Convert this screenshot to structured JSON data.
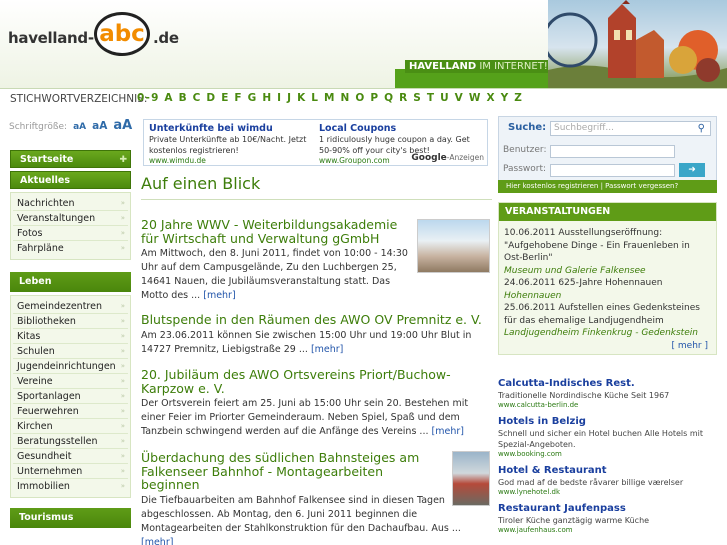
{
  "header": {
    "logo_left": "havelland-",
    "logo_abc": "abc",
    "logo_right": ".de",
    "slogan_main": "HAVELLAND",
    "slogan_rest": " IM INTERNET!"
  },
  "stichwort": {
    "label": "STICHWORTVERZEICHNIS:",
    "letters": "0-9 A B C D E F G H I J K L M N O P Q R S T U V W X Y Z"
  },
  "fontsize": {
    "label": "Schriftgröße:",
    "small": "aA",
    "medium": "aA",
    "large": "aA"
  },
  "nav": {
    "startseite": "Startseite",
    "aktuelles": "Aktuelles",
    "aktuelles_items": [
      "Nachrichten",
      "Veranstaltungen",
      "Fotos",
      "Fahrpläne"
    ],
    "leben": "Leben",
    "leben_items": [
      "Gemeindezentren",
      "Bibliotheken",
      "Kitas",
      "Schulen",
      "Jugendeinrichtungen",
      "Vereine",
      "Sportanlagen",
      "Feuerwehren",
      "Kirchen",
      "Beratungsstellen",
      "Gesundheit",
      "Unternehmen",
      "Immobilien"
    ],
    "tourismus": "Tourismus"
  },
  "ads_top": [
    {
      "title": "Unterkünfte bei wimdu",
      "desc": "Private Unterkünfte ab 10€/Nacht. Jetzt kostenlos registrieren!",
      "url": "www.wimdu.de"
    },
    {
      "title": "Local Coupons",
      "desc": "1 ridiculously huge coupon a day. Get 50-90% off your city's best!",
      "url": "www.Groupon.com"
    }
  ],
  "google_label": "Google",
  "google_suffix": "-Anzeigen",
  "main": {
    "title": "Auf einen Blick",
    "articles": [
      {
        "headline": "20 Jahre WWV - Weiterbildungsakademie für Wirtschaft und Verwaltung gGmbH",
        "body": "Am Mittwoch, den 8. Juni 2011, findet von 10:00 - 14:30 Uhr auf dem Campusgelände, Zu den Luchbergen 25, 14641 Nauen, die Jubiläumsveranstaltung statt.   Das Motto des ...",
        "more": "[mehr]"
      },
      {
        "headline": "Blutspende in den Räumen des AWO OV Premnitz e. V.",
        "body": "Am 23.06.2011 können Sie zwischen 15:00 Uhr und 19:00 Uhr Blut in 14727 Premnitz, Liebigstraße 29 ...",
        "more": "[mehr]"
      },
      {
        "headline": "20. Jubiläum des AWO Ortsvereins Priort/Buchow-Karpzow e. V.",
        "body": "Der Ortsverein feiert am 25. Juni ab 15:00 Uhr sein 20. Bestehen mit einer Feier im Priorter Gemeinderaum. Neben Spiel, Spaß und dem Tanzbein schwingend werden auf die Anfänge des Vereins ...",
        "more": "[mehr]"
      },
      {
        "headline": "Überdachung des südlichen Bahnsteiges am Falkenseer Bahnhof - Montagearbeiten beginnen",
        "body": "Die Tiefbauarbeiten am Bahnhof Falkensee sind in diesen Tagen abgeschlossen. Ab Montag, den 6. Juni 2011 beginnen die Montagearbeiten der Stahlkonstruktion für den Dachaufbau. Aus ...",
        "more": "[mehr]"
      }
    ]
  },
  "search": {
    "label": "Suche:",
    "placeholder": "Suchbegriff...",
    "user_label": "Benutzer:",
    "pass_label": "Passwort:",
    "go": "➜",
    "links": "Hier kostenlos registrieren  |  Passwort vergessen?"
  },
  "veranstaltungen": {
    "head": "VERANSTALTUNGEN",
    "events": [
      {
        "text": "10.06.2011 Ausstellungseröffnung: \"Aufgehobene Dinge - Ein Frauenleben in Ost-Berlin\"",
        "loc": "Museum und Galerie Falkensee"
      },
      {
        "text": "24.06.2011 625-Jahre Hohennauen",
        "loc": "Hohennauen"
      },
      {
        "text": "25.06.2011 Aufstellen eines Gedenksteines für das ehemalige Landjugendheim",
        "loc": "Landjugendheim Finkenkrug - Gedenkstein"
      }
    ],
    "more": "[ mehr ]"
  },
  "right_ads": [
    {
      "title": "Calcutta-Indisches Rest.",
      "desc": "Traditionelle Nordindische Küche Seit 1967",
      "url": "www.calcutta-berlin.de"
    },
    {
      "title": "Hotels in Belzig",
      "desc": "Schnell und sicher ein Hotel buchen Alle Hotels mit Spezial-Angeboten.",
      "url": "www.booking.com"
    },
    {
      "title": "Hotel & Restaurant",
      "desc": "God mad af de bedste råvarer billige værelser",
      "url": "www.lynehotel.dk"
    },
    {
      "title": "Restaurant Jaufenpass",
      "desc": "Tiroler Küche ganztägig warme Küche",
      "url": "www.jaufenhaus.com"
    }
  ]
}
